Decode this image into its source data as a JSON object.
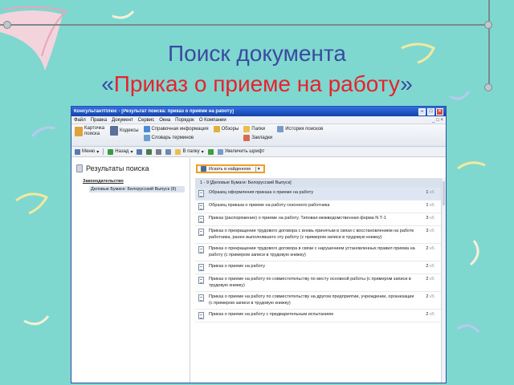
{
  "slide": {
    "title_line1": "Поиск документа",
    "title_quote_open": "«",
    "title_accent": "Приказ о приеме на работу",
    "title_quote_close": "»"
  },
  "window": {
    "title": "КонсультантПлюс - [Результат поиска: приказ о приёме на работу]",
    "menu": [
      "Файл",
      "Правка",
      "Документ",
      "Сервис",
      "Окна",
      "Порядок",
      "О Компании"
    ],
    "ribbon": {
      "card_search": "Карточка поиска",
      "codexes": "Кодексы",
      "reference": "Справочная информация",
      "dictionary": "Словарь терминов",
      "reviews": "Обзоры",
      "folders": "Папки",
      "bookmarks": "Закладки",
      "history": "История поисков"
    },
    "toolbar": {
      "menu": "Меню",
      "back": "Назад",
      "to_folder": "В папку",
      "zoom": "Увеличить шрифт"
    }
  },
  "left_panel": {
    "heading": "Результаты поиска",
    "section": "Законодательство",
    "item": "Деловые Бумаги: Белорусский Выпуск (9)"
  },
  "right_panel": {
    "find_button": "Искать в найденном",
    "header": "1 - 9 [Деловые Бумаги: Белорусский Выпуск]",
    "kb_unit": "кБ",
    "rows": [
      {
        "text": "Образец оформления приказа о приеме на работу",
        "size": "1"
      },
      {
        "text": "Образец приказа о приеме на работу сезонного работника",
        "size": "1"
      },
      {
        "text": "Приказ (распоряжение) о приеме на работу. Типовая межведомственная форма N Т-1",
        "size": "3"
      },
      {
        "text": "Приказ о прекращении трудового договора с вновь принятым в связи с восстановлением на работе работника, ранее выполнявшего эту работу (с примером записи в трудовую книжку)",
        "size": "3"
      },
      {
        "text": "Приказ о прекращении трудового договора в связи с нарушением установленных правил приема на работу (с примером записи в трудовую книжку)",
        "size": "2"
      },
      {
        "text": "Приказ о приеме на работу",
        "size": "2"
      },
      {
        "text": "Приказ о приеме на работу по совместительству по месту основной работы (с примером записи в трудовую книжку)",
        "size": "2"
      },
      {
        "text": "Приказ о приеме на работу по совместительству на другом предприятии, учреждении, организации (с примером записи в трудовую книжку)",
        "size": "2"
      },
      {
        "text": "Приказ о приеме на работу с предварительным испытанием",
        "size": "2"
      }
    ]
  },
  "colors": {
    "background": "#7fd8cf",
    "title": "#3a4aa0",
    "accent": "#e8222d",
    "find_highlight": "#f0a020"
  }
}
